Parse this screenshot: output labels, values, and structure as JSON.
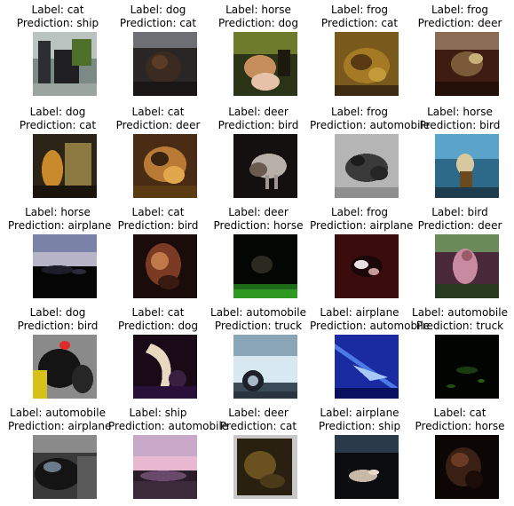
{
  "grid": [
    {
      "label": "Label: cat",
      "prediction": "Prediction: ship",
      "content": "cat photo"
    },
    {
      "label": "Label: dog",
      "prediction": "Prediction: cat",
      "content": "dog photo"
    },
    {
      "label": "Label: horse",
      "prediction": "Prediction: dog",
      "content": "horse photo"
    },
    {
      "label": "Label: frog",
      "prediction": "Prediction: cat",
      "content": "frog photo"
    },
    {
      "label": "Label: frog",
      "prediction": "Prediction: deer",
      "content": "frog photo"
    },
    {
      "label": "Label: dog",
      "prediction": "Prediction: cat",
      "content": "dog photo"
    },
    {
      "label": "Label: cat",
      "prediction": "Prediction: deer",
      "content": "cat photo"
    },
    {
      "label": "Label: deer",
      "prediction": "Prediction: bird",
      "content": "deer photo"
    },
    {
      "label": "Label: frog",
      "prediction": "Prediction: automobile",
      "content": "frog photo"
    },
    {
      "label": "Label: horse",
      "prediction": "Prediction: bird",
      "content": "horse photo"
    },
    {
      "label": "Label: horse",
      "prediction": "Prediction: airplane",
      "content": "horse photo"
    },
    {
      "label": "Label: cat",
      "prediction": "Prediction: bird",
      "content": "cat photo"
    },
    {
      "label": "Label: deer",
      "prediction": "Prediction: horse",
      "content": "deer photo"
    },
    {
      "label": "Label: frog",
      "prediction": "Prediction: airplane",
      "content": "frog photo"
    },
    {
      "label": "Label: bird",
      "prediction": "Prediction: deer",
      "content": "bird photo"
    },
    {
      "label": "Label: dog",
      "prediction": "Prediction: bird",
      "content": "dog photo"
    },
    {
      "label": "Label: cat",
      "prediction": "Prediction: dog",
      "content": "cat photo"
    },
    {
      "label": "Label: automobile",
      "prediction": "Prediction: truck",
      "content": "automobile photo"
    },
    {
      "label": "Label: airplane",
      "prediction": "Prediction: automobile",
      "content": "airplane photo"
    },
    {
      "label": "Label: automobile",
      "prediction": "Prediction: truck",
      "content": "automobile photo"
    },
    {
      "label": "Label: automobile",
      "prediction": "Prediction: airplane",
      "content": "automobile photo"
    },
    {
      "label": "Label: ship",
      "prediction": "Prediction: automobile",
      "content": "ship photo"
    },
    {
      "label": "Label: deer",
      "prediction": "Prediction: cat",
      "content": "deer photo"
    },
    {
      "label": "Label: airplane",
      "prediction": "Prediction: ship",
      "content": "airplane photo"
    },
    {
      "label": "Label: cat",
      "prediction": "Prediction: horse",
      "content": "cat photo"
    }
  ]
}
